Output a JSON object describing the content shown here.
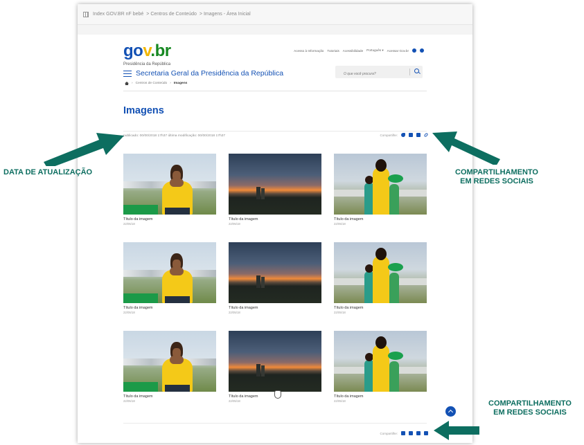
{
  "browser": {
    "breadcrumb_url": [
      "Index GOV.BR nF bebé",
      "Centros de Conteúdo",
      "Imagens - Área Inicial"
    ]
  },
  "header": {
    "logo": {
      "g1": "go",
      "g2": "v",
      "g3": ".br"
    },
    "presidencia": "Presidência da República",
    "secretaria": "Secretaria Geral da Presidência da República",
    "top_links": [
      "Acesso à Informação",
      "Tutoriais",
      "Acessibilidade",
      "Português ▾",
      "Acessar Gov.br"
    ],
    "search_placeholder": "O que você procura?"
  },
  "breadcrumb": {
    "items": [
      "Centros de Conteúdo"
    ],
    "current": "Imagens"
  },
  "page": {
    "title": "Imagens",
    "published": "publicado: 00/00/2018 17h37 última modificação: 00/00/2018 17h37",
    "share_label": "Compartilhe:"
  },
  "gallery": [
    {
      "title": "Título da imagem",
      "date": "22/05/18",
      "photo": "man"
    },
    {
      "title": "Título da imagem",
      "date": "22/05/18",
      "photo": "sunset"
    },
    {
      "title": "Título da imagem",
      "date": "22/05/18",
      "photo": "women"
    },
    {
      "title": "Título da imagem",
      "date": "22/05/18",
      "photo": "man"
    },
    {
      "title": "Título da imagem",
      "date": "22/05/18",
      "photo": "sunset"
    },
    {
      "title": "Título da imagem",
      "date": "22/05/18",
      "photo": "women"
    },
    {
      "title": "Título da imagem",
      "date": "22/05/18",
      "photo": "man"
    },
    {
      "title": "Título da imagem",
      "date": "22/05/18",
      "photo": "sunset"
    },
    {
      "title": "Título da imagem",
      "date": "22/05/18",
      "photo": "women"
    }
  ],
  "annotations": {
    "left": "DATA DE ATUALIZAÇÃO",
    "right_top_line1": "COMPARTILHAMENTO",
    "right_top_line2": "EM REDES SOCIAIS",
    "right_bottom_line1": "COMPARTILHAMENTO",
    "right_bottom_line2": "EM REDES SOCIAIS"
  },
  "share_icons": [
    "twitter-icon",
    "linkedin-icon",
    "facebook-icon",
    "link-icon"
  ],
  "colors": {
    "brand_blue": "#1351b4",
    "arrow_green": "#0d6e60",
    "logo_yellow": "#f2b705",
    "logo_green": "#168821"
  }
}
